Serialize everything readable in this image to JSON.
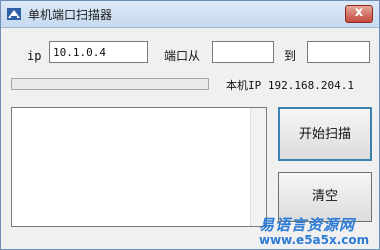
{
  "window": {
    "title": "单机端口扫描器",
    "close_glyph": "x",
    "icon": "scanner-app-icon"
  },
  "form": {
    "ip_label": "ip",
    "ip_value": "10.1.0.4",
    "port_from_label": "端口从",
    "port_start_value": "",
    "port_to_label": "到",
    "port_end_value": ""
  },
  "status": {
    "progress_fraction": 0,
    "local_ip_text": "本机IP 192.168.204.1"
  },
  "buttons": {
    "scan_label": "开始扫描",
    "clear_label": "清空"
  },
  "watermark": {
    "site_name": "易语言资源网",
    "site_url": "www.e5a5x.com"
  },
  "colors": {
    "accent": "#3c7fb1",
    "close_red": "#c3483a",
    "watermark_blue": "#2e7bd6"
  }
}
